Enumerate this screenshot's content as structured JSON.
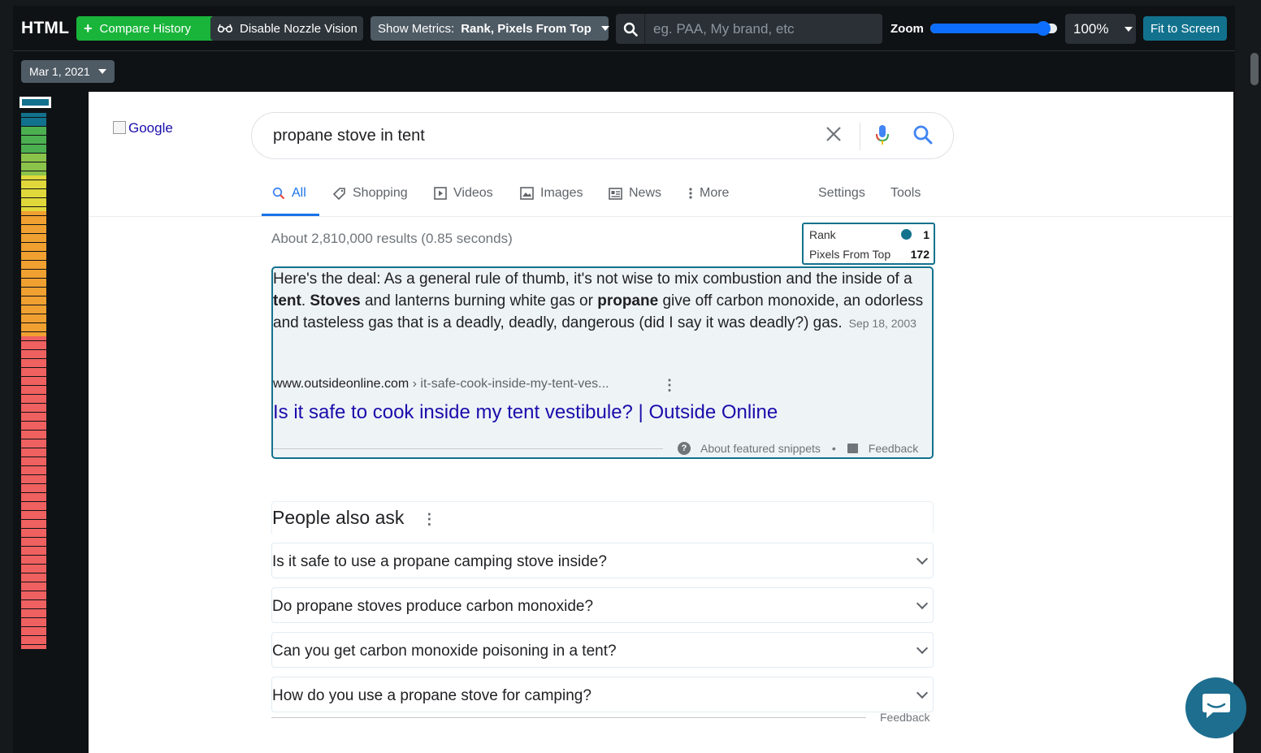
{
  "toolbar": {
    "title": "HTML",
    "compare_history": "Compare History",
    "disable_vision": "Disable Nozzle Vision",
    "show_metrics_label": "Show Metrics:",
    "show_metrics_value": "Rank, Pixels From Top",
    "search_placeholder": "eg. PAA, My brand, etc",
    "zoom_label": "Zoom",
    "zoom_value": "100%",
    "fit_to_screen": "Fit to Screen",
    "date": "Mar 1, 2021",
    "accent": "#12728e",
    "green": "#19b43a"
  },
  "minimap": {
    "segments": [
      {
        "color": "#12728e",
        "count": 3
      },
      {
        "color": "#4caf50",
        "count": 6
      },
      {
        "color": "#8bc34a",
        "count": 5
      },
      {
        "color": "#e0d83a",
        "count": 8
      },
      {
        "color": "#f0a030",
        "count": 28
      },
      {
        "color": "#ef6060",
        "count": 70
      }
    ]
  },
  "serp": {
    "logo_alt": "Google",
    "query": "propane stove in tent",
    "tabs": {
      "all": "All",
      "shopping": "Shopping",
      "videos": "Videos",
      "images": "Images",
      "news": "News",
      "more": "More",
      "settings": "Settings",
      "tools": "Tools"
    },
    "results_count": "About 2,810,000 results (0.85 seconds)",
    "metrics": {
      "rank_label": "Rank",
      "rank_value": "1",
      "pixels_label": "Pixels From Top",
      "pixels_value": "172"
    },
    "snippet": {
      "text_1": "Here's the deal: As a general rule of thumb, it's not wise to mix combustion and the inside of a ",
      "bold_1": "tent",
      "text_2": ". ",
      "bold_2": "Stoves",
      "text_3": " and lanterns burning white gas or ",
      "bold_3": "propane",
      "text_4": " give off carbon monoxide, an odorless and tasteless gas that is a deadly, deadly, dangerous (did I say it was deadly?) gas.",
      "date": "Sep 18, 2003",
      "url_domain": "www.outsideonline.com",
      "url_crumb": " › it-safe-cook-inside-my-tent-ves...",
      "title": "Is it safe to cook inside my tent vestibule? | Outside Online",
      "about": "About featured snippets",
      "dot": "•",
      "feedback": "Feedback"
    },
    "paa": {
      "heading": "People also ask",
      "questions": [
        "Is it safe to use a propane camping stove inside?",
        "Do propane stoves produce carbon monoxide?",
        "Can you get carbon monoxide poisoning in a tent?",
        "How do you use a propane stove for camping?"
      ],
      "feedback": "Feedback"
    }
  }
}
